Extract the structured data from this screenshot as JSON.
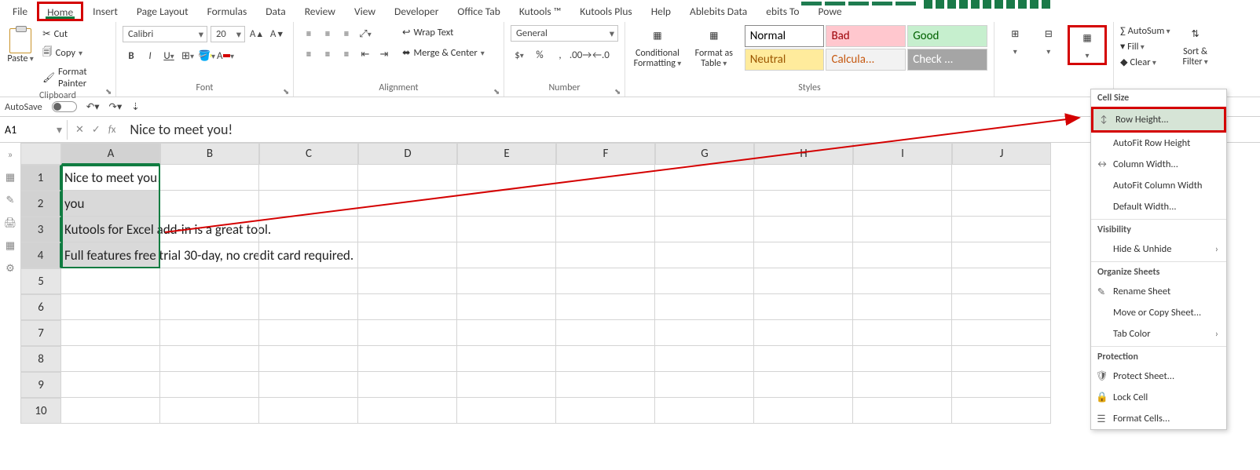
{
  "tabs": {
    "file": "File",
    "home": "Home",
    "insert": "Insert",
    "page_layout": "Page Layout",
    "formulas": "Formulas",
    "data": "Data",
    "review": "Review",
    "view": "View",
    "developer": "Developer",
    "office_tab": "Office Tab",
    "kutools": "Kutools ™",
    "kutools_plus": "Kutools Plus",
    "help": "Help",
    "ablebits": "Ablebits Data",
    "ebits": "ebits To",
    "powe": "Powe"
  },
  "clipboard": {
    "paste": "Paste",
    "cut": "Cut",
    "copy": "Copy",
    "painter": "Format Painter",
    "label": "Clipboard"
  },
  "font": {
    "name": "Calibri",
    "size": "20",
    "label": "Font"
  },
  "alignment": {
    "wrap": "Wrap Text",
    "merge": "Merge & Center",
    "label": "Alignment"
  },
  "number": {
    "format": "General",
    "label": "Number"
  },
  "styles": {
    "cond": "Conditional Formatting",
    "fmt_table": "Format as Table",
    "normal": "Normal",
    "bad": "Bad",
    "good": "Good",
    "neutral": "Neutral",
    "calc": "Calcula...",
    "check": "Check ...",
    "label": "Styles"
  },
  "cells": {
    "1": "Nice to meet you!",
    "2": "you",
    "3": "Kutools for Excel add-in is a great tool.",
    "4": "Full features free trial 30-day, no credit card required."
  },
  "editing": {
    "autosum": "AutoSum",
    "fill": "Fill",
    "clear": "Clear",
    "sort": "Sort & Filter",
    "label": ""
  },
  "qat": {
    "autosave": "AutoSave"
  },
  "namebox": "A1",
  "formula": "Nice to meet you!",
  "cols": [
    "A",
    "B",
    "C",
    "D",
    "E",
    "F",
    "G",
    "H",
    "I",
    "J"
  ],
  "rows": [
    1,
    2,
    3,
    4,
    5,
    6,
    7,
    8,
    9,
    10
  ],
  "menu": {
    "cell_size": "Cell Size",
    "row_height": "Row Height...",
    "autofit_row": "AutoFit Row Height",
    "col_width": "Column Width...",
    "autofit_col": "AutoFit Column Width",
    "def_width": "Default Width...",
    "visibility": "Visibility",
    "hide": "Hide & Unhide",
    "organize": "Organize Sheets",
    "rename": "Rename Sheet",
    "move": "Move or Copy Sheet...",
    "tab_color": "Tab Color",
    "protection": "Protection",
    "protect": "Protect Sheet...",
    "lock": "Lock Cell",
    "fmt_cells": "Format Cells..."
  }
}
